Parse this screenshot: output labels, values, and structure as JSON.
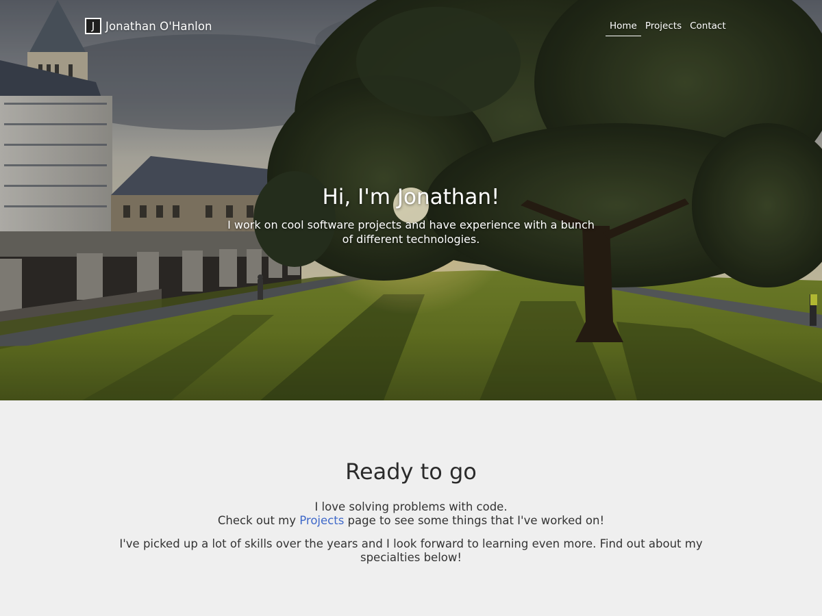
{
  "header": {
    "brand_letter": "J",
    "brand_name": "Jonathan O'Hanlon",
    "nav": [
      {
        "label": "Home",
        "active": true
      },
      {
        "label": "Projects",
        "active": false
      },
      {
        "label": "Contact",
        "active": false
      }
    ]
  },
  "hero": {
    "title": "Hi, I'm Jonathan!",
    "subtitle": "I work on cool software projects and have experience with a bunch of different technologies."
  },
  "intro": {
    "title": "Ready to go",
    "line1": "I love solving problems with code.",
    "line2_before": "Check out my ",
    "line2_link": "Projects",
    "line2_after": " page to see some things that I've worked on!",
    "paragraph2": "I've picked up a lot of skills over the years and I look forward to learning even more. Find out about my specialties below!"
  },
  "colors": {
    "page_background": "#efefef",
    "link": "#3e68c9",
    "text": "#333333"
  }
}
